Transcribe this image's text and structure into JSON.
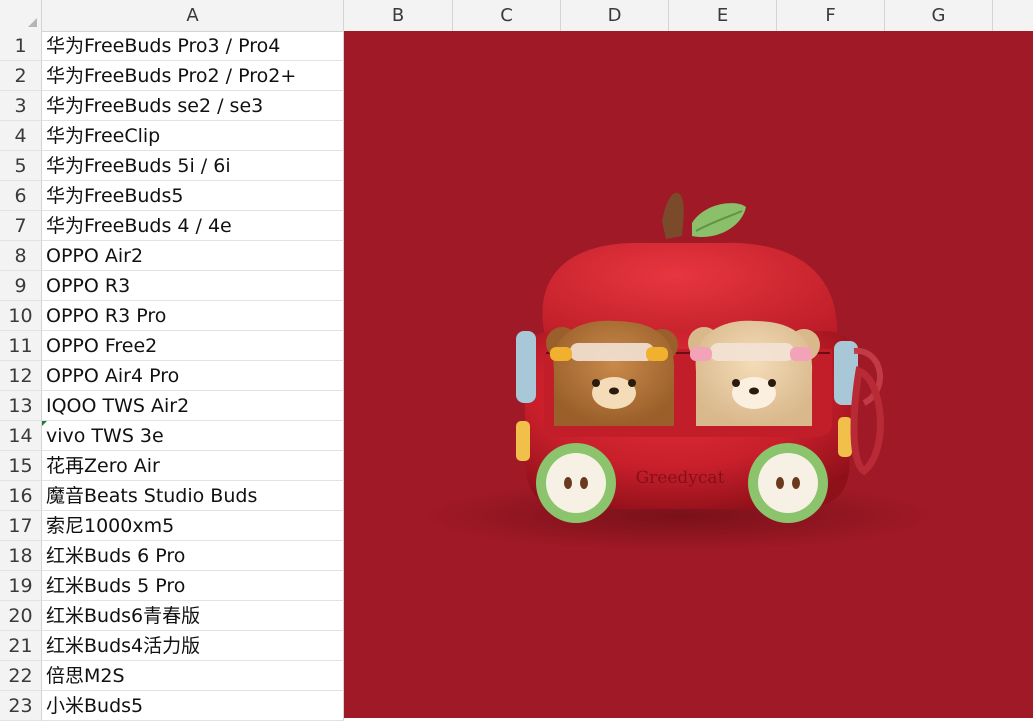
{
  "columns": [
    "A",
    "B",
    "C",
    "D",
    "E",
    "F",
    "G"
  ],
  "rows": [
    {
      "num": "1",
      "text": "华为FreeBuds Pro3 / Pro4"
    },
    {
      "num": "2",
      "text": "华为FreeBuds Pro2 / Pro2+"
    },
    {
      "num": "3",
      "text": "华为FreeBuds se2 / se3"
    },
    {
      "num": "4",
      "text": "华为FreeClip"
    },
    {
      "num": "5",
      "text": "华为FreeBuds 5i / 6i"
    },
    {
      "num": "6",
      "text": "华为FreeBuds5"
    },
    {
      "num": "7",
      "text": "华为FreeBuds 4 / 4e"
    },
    {
      "num": "8",
      "text": "OPPO Air2"
    },
    {
      "num": "9",
      "text": "OPPO R3"
    },
    {
      "num": "10",
      "text": "OPPO R3 Pro"
    },
    {
      "num": "11",
      "text": "OPPO Free2"
    },
    {
      "num": "12",
      "text": "OPPO Air4 Pro"
    },
    {
      "num": "13",
      "text": "IQOO TWS Air2"
    },
    {
      "num": "14",
      "text": "vivo TWS 3e"
    },
    {
      "num": "15",
      "text": "花再Zero Air"
    },
    {
      "num": "16",
      "text": "魔音Beats Studio Buds"
    },
    {
      "num": "17",
      "text": "索尼1000xm5"
    },
    {
      "num": "18",
      "text": "红米Buds 6 Pro"
    },
    {
      "num": "19",
      "text": "红米Buds 5 Pro"
    },
    {
      "num": "20",
      "text": "红米Buds6青春版"
    },
    {
      "num": "21",
      "text": "红米Buds4活力版"
    },
    {
      "num": "22",
      "text": "倍思M2S"
    },
    {
      "num": "23",
      "text": "小米Buds5"
    }
  ],
  "image": {
    "brand_text": "Greedycat",
    "background_color": "#a01926"
  }
}
